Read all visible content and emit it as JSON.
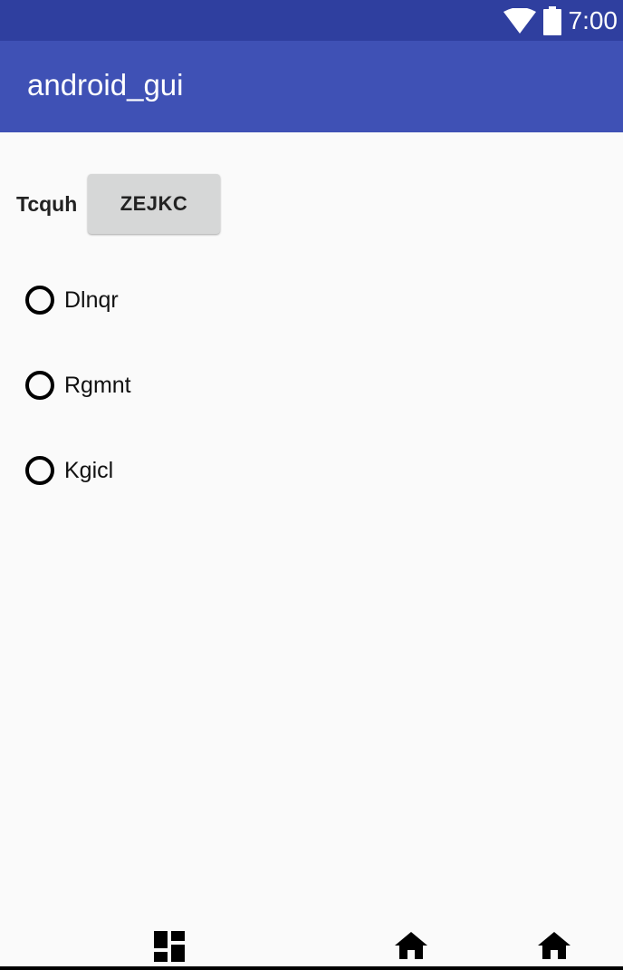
{
  "status_bar": {
    "time": "7:00",
    "wifi_icon": "wifi-icon",
    "battery_icon": "battery-icon"
  },
  "app_bar": {
    "title": "android_gui"
  },
  "form": {
    "label": "Tcquh",
    "button_label": "ZEJKC"
  },
  "radio_options": [
    {
      "label": "Dlnqr",
      "checked": false
    },
    {
      "label": "Rgmnt",
      "checked": false
    },
    {
      "label": "Kgicl",
      "checked": false
    }
  ],
  "nav_bar": {
    "icons": [
      "dashboard-icon",
      "home-icon",
      "home-icon"
    ]
  },
  "colors": {
    "status_bar": "#2f3f9f",
    "app_bar": "#3f51b5",
    "background": "#fafafa",
    "button": "#d6d7d7"
  }
}
